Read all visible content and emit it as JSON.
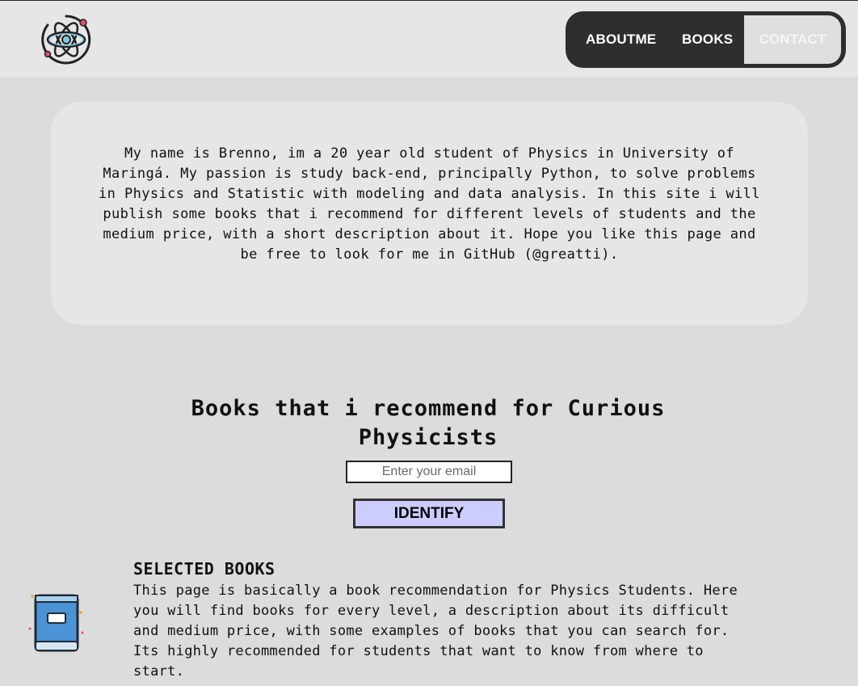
{
  "header": {
    "nav": [
      {
        "label": "ABOUTME"
      },
      {
        "label": "BOOKS"
      },
      {
        "label": "CONTACT"
      }
    ],
    "logo_icon": "atom-icon"
  },
  "about": {
    "text": "My name is Brenno, im a 20 year old student of Physics in University of Maringá. My passion is study back-end, principally Python, to solve problems in Physics and Statistic with modeling and data analysis. In this site i will publish some books that i recommend for different levels of students and the medium price, with a short description about it. Hope you like this page and be free to look for me in GitHub (@greatti)."
  },
  "books": {
    "title": "Books that i recommend for Curious Physicists",
    "email_placeholder": "Enter your email",
    "identify_label": "IDENTIFY"
  },
  "selected": {
    "icon": "book-icon",
    "title": "SELECTED BOOKS",
    "text": "This page is basically a book recommendation for Physics Students. Here you will find books for every level, a description about its difficult and medium price, with some examples of books that you can search for. Its highly recommended for students that want to know from where to start."
  },
  "colors": {
    "page_bg": "#dcdcdc",
    "header_bg": "#e6e6e6",
    "nav_bg": "#2e2e2e",
    "button_bg": "#ccccff"
  }
}
